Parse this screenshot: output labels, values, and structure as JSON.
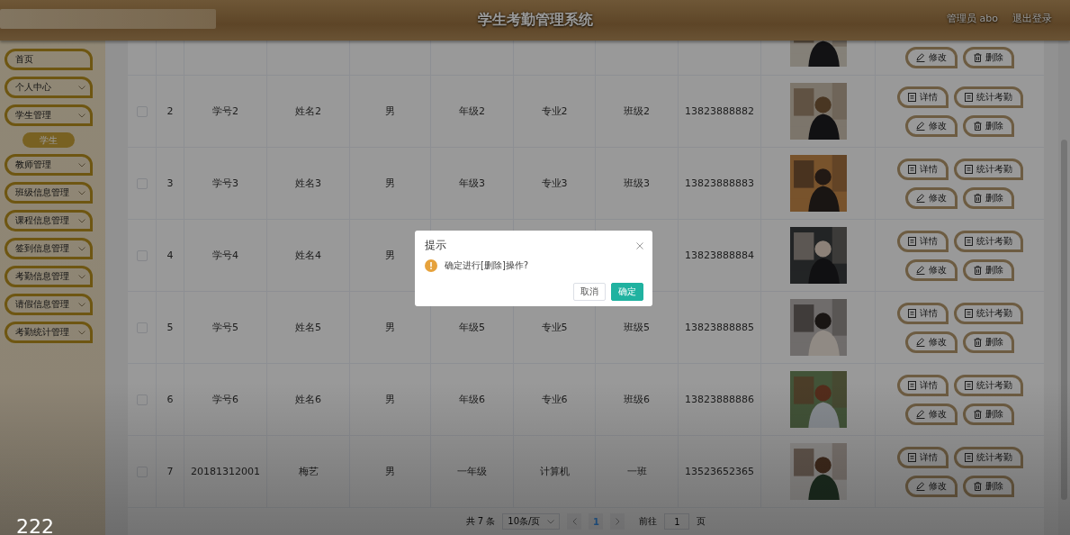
{
  "header": {
    "title": "学生考勤管理系统",
    "user": "管理员 abo",
    "logout": "退出登录"
  },
  "sidebar": {
    "items": [
      {
        "label": "首页",
        "kind": "link"
      },
      {
        "label": "个人中心",
        "kind": "menu"
      },
      {
        "label": "学生管理",
        "kind": "menu",
        "children": [
          {
            "label": "学生",
            "selected": true
          }
        ]
      },
      {
        "label": "教师管理",
        "kind": "menu"
      },
      {
        "label": "班级信息管理",
        "kind": "menu"
      },
      {
        "label": "课程信息管理",
        "kind": "menu"
      },
      {
        "label": "签到信息管理",
        "kind": "menu"
      },
      {
        "label": "考勤信息管理",
        "kind": "menu"
      },
      {
        "label": "请假信息管理",
        "kind": "menu"
      },
      {
        "label": "考勤统计管理",
        "kind": "menu"
      }
    ]
  },
  "table": {
    "rows": [
      {
        "kind": "partial",
        "actions": [
          {
            "label": "修改",
            "kind": "edit"
          },
          {
            "label": "删除",
            "kind": "delete"
          }
        ]
      },
      {
        "kind": "full",
        "checked": false,
        "cells": [
          "2",
          "学号2",
          "姓名2",
          "男",
          "年级2",
          "专业2",
          "班级2",
          "13823888882"
        ],
        "actions": [
          {
            "label": "详情",
            "kind": "doc"
          },
          {
            "label": "统计考勤",
            "kind": "doc"
          },
          {
            "label": "修改",
            "kind": "edit"
          },
          {
            "label": "删除",
            "kind": "delete"
          }
        ]
      },
      {
        "kind": "full",
        "checked": false,
        "cells": [
          "3",
          "学号3",
          "姓名3",
          "男",
          "年级3",
          "专业3",
          "班级3",
          "13823888883"
        ],
        "actions": [
          {
            "label": "详情",
            "kind": "doc"
          },
          {
            "label": "统计考勤",
            "kind": "doc"
          },
          {
            "label": "修改",
            "kind": "edit"
          },
          {
            "label": "删除",
            "kind": "delete"
          }
        ]
      },
      {
        "kind": "full",
        "checked": false,
        "cells": [
          "4",
          "学号4",
          "姓名4",
          "男",
          "",
          "",
          "",
          "13823888884"
        ],
        "actions": [
          {
            "label": "详情",
            "kind": "doc"
          },
          {
            "label": "统计考勤",
            "kind": "doc"
          },
          {
            "label": "修改",
            "kind": "edit"
          },
          {
            "label": "删除",
            "kind": "delete"
          }
        ]
      },
      {
        "kind": "full",
        "checked": false,
        "cells": [
          "5",
          "学号5",
          "姓名5",
          "男",
          "年级5",
          "专业5",
          "班级5",
          "13823888885"
        ],
        "actions": [
          {
            "label": "详情",
            "kind": "doc"
          },
          {
            "label": "统计考勤",
            "kind": "doc"
          },
          {
            "label": "修改",
            "kind": "edit"
          },
          {
            "label": "删除",
            "kind": "delete"
          }
        ]
      },
      {
        "kind": "full",
        "checked": false,
        "cells": [
          "6",
          "学号6",
          "姓名6",
          "男",
          "年级6",
          "专业6",
          "班级6",
          "13823888886"
        ],
        "actions": [
          {
            "label": "详情",
            "kind": "doc"
          },
          {
            "label": "统计考勤",
            "kind": "doc"
          },
          {
            "label": "修改",
            "kind": "edit"
          },
          {
            "label": "删除",
            "kind": "delete"
          }
        ]
      },
      {
        "kind": "full",
        "checked": false,
        "cells": [
          "7",
          "20181312001",
          "梅艺",
          "男",
          "一年级",
          "计算机",
          "一班",
          "13523652365"
        ],
        "actions": [
          {
            "label": "详情",
            "kind": "doc"
          },
          {
            "label": "统计考勤",
            "kind": "doc"
          },
          {
            "label": "修改",
            "kind": "edit"
          },
          {
            "label": "删除",
            "kind": "delete"
          }
        ]
      }
    ]
  },
  "pagination": {
    "total": "共 7 条",
    "page_size": "10条/页",
    "pages": [
      {
        "label": "1",
        "selected": true
      }
    ],
    "goto_label": "前往",
    "goto_value": "1",
    "page_suffix": "页"
  },
  "dialog": {
    "title": "提示",
    "message": "确定进行[删除]操作?",
    "cancel": "取消",
    "confirm": "确定"
  },
  "corner_text": "222"
}
